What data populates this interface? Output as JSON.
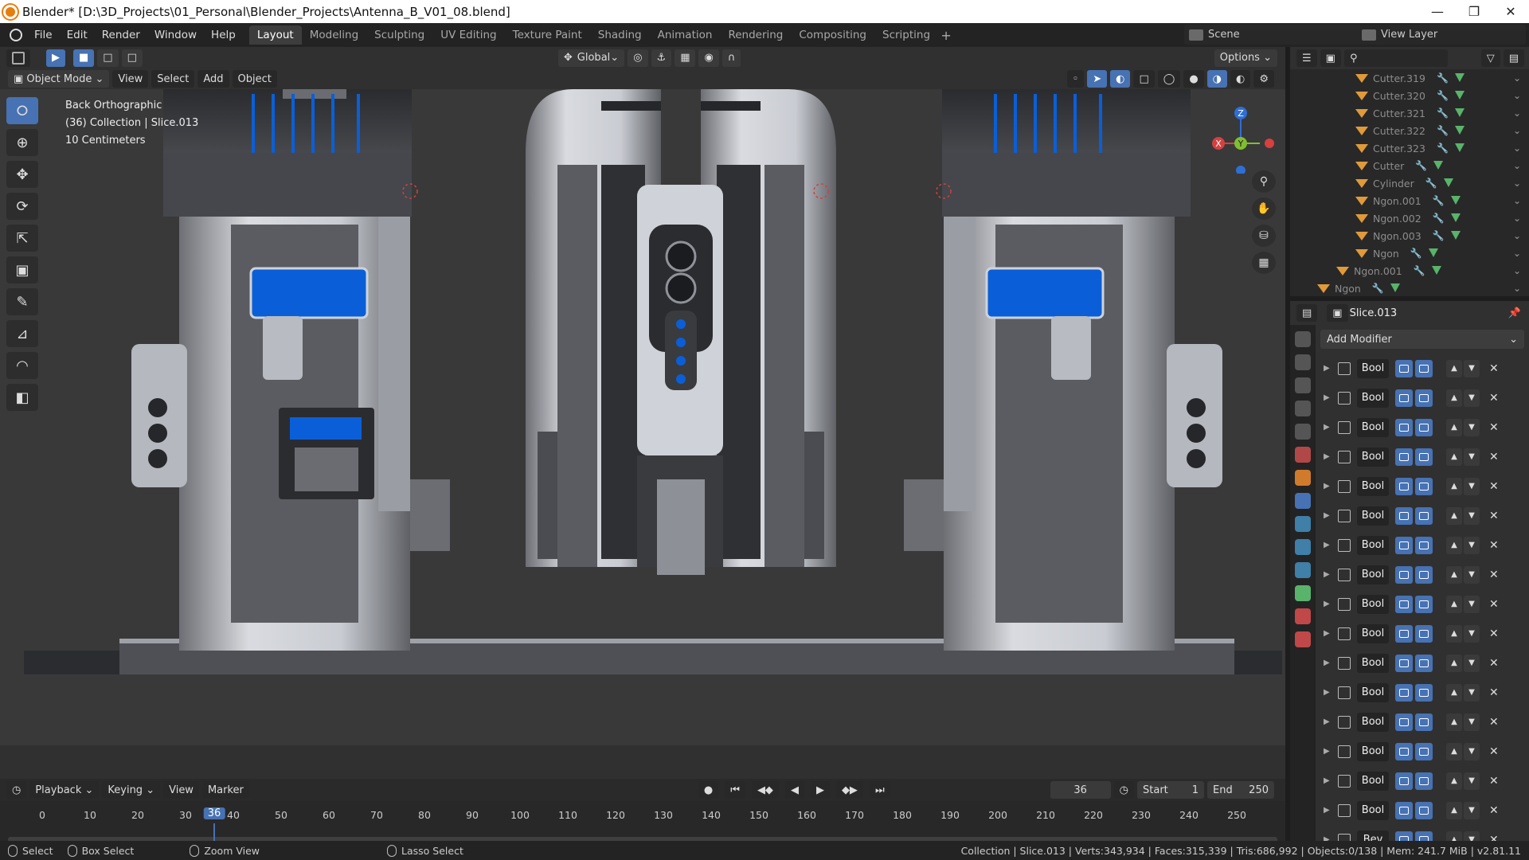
{
  "window": {
    "title": "Blender* [D:\\3D_Projects\\01_Personal\\Blender_Projects\\Antenna_B_V01_08.blend]"
  },
  "menu": [
    "File",
    "Edit",
    "Render",
    "Window",
    "Help"
  ],
  "workspaces": [
    "Layout",
    "Modeling",
    "Sculpting",
    "UV Editing",
    "Texture Paint",
    "Shading",
    "Animation",
    "Rendering",
    "Compositing",
    "Scripting"
  ],
  "active_workspace": "Layout",
  "scene": {
    "label": "Scene"
  },
  "view_layer": {
    "label": "View Layer"
  },
  "header": {
    "transform_orientation": "Global",
    "options_label": "Options"
  },
  "viewport_menu": {
    "mode": "Object Mode",
    "items": [
      "View",
      "Select",
      "Add",
      "Object"
    ]
  },
  "viewport_info": {
    "view": "Back Orthographic",
    "collection": "(36) Collection | Slice.013",
    "scale": "10 Centimeters"
  },
  "gizmo_axes": {
    "x": "X",
    "y": "Y",
    "z": "Z"
  },
  "outliner": {
    "items": [
      "Cutter.319",
      "Cutter.320",
      "Cutter.321",
      "Cutter.322",
      "Cutter.323",
      "Cutter",
      "Cylinder",
      "Ngon.001",
      "Ngon.002",
      "Ngon.003",
      "Ngon",
      "Ngon.001",
      "Ngon"
    ]
  },
  "properties": {
    "object_name": "Slice.013",
    "add_modifier": "Add Modifier",
    "modifiers": [
      "Bool",
      "Bool",
      "Bool",
      "Bool",
      "Bool",
      "Bool",
      "Bool",
      "Bool",
      "Bool",
      "Bool",
      "Bool",
      "Bool",
      "Bool",
      "Bool",
      "Bool",
      "Bool",
      "Bev"
    ]
  },
  "timeline": {
    "menus": [
      "Playback",
      "Keying",
      "View",
      "Marker"
    ],
    "current_frame": "36",
    "start_label": "Start",
    "start": "1",
    "end_label": "End",
    "end": "250",
    "ticks": [
      "0",
      "10",
      "20",
      "30",
      "40",
      "50",
      "60",
      "70",
      "80",
      "90",
      "100",
      "110",
      "120",
      "130",
      "140",
      "150",
      "160",
      "170",
      "180",
      "190",
      "200",
      "210",
      "220",
      "230",
      "240",
      "250"
    ]
  },
  "statusbar": {
    "select": "Select",
    "box_select": "Box Select",
    "zoom_view": "Zoom View",
    "lasso_select": "Lasso Select",
    "stats": "Collection | Slice.013 | Verts:343,934 | Faces:315,339 | Tris:686,992 | Objects:0/138 | Mem: 241.7 MiB | v2.81.11"
  },
  "colors": {
    "accent": "#4772b3",
    "model_blue": "#0a5fd8",
    "orange": "#e09a3a",
    "green": "#59b36b"
  }
}
